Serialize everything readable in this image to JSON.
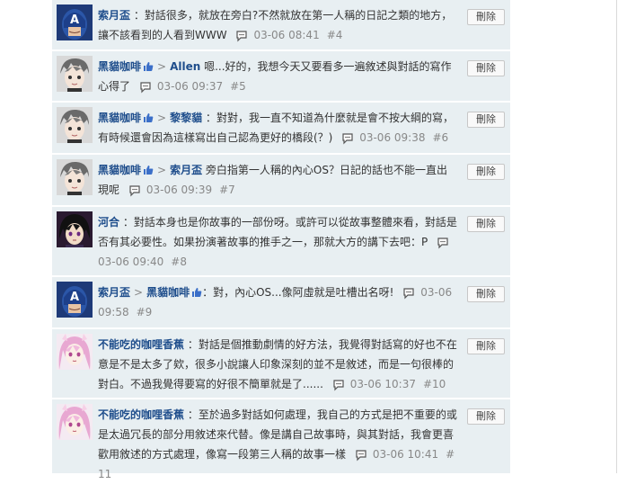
{
  "delete_label": "刪除",
  "comments": [
    {
      "author": "索月盃",
      "reply_to": "",
      "text": "對話很多，就放在旁白?不然就放在第一人稱的日記之類的地方，讓不該看到的人看到WWW",
      "time": "03-06 08:41",
      "floor": "#4",
      "avatar": "captain-america-avatar"
    },
    {
      "author": "黑貓咖啡",
      "reply_to": "Allen",
      "text": "嗯...好的，我想今天又要看多一遍敘述與對話的寫作心得了",
      "time": "03-06 09:37",
      "floor": "#5",
      "avatar": "anime-boy-avatar"
    },
    {
      "author": "黑貓咖啡",
      "reply_to": "黎黎貓",
      "text": "對對，我一直不知道為什麼就是會不按大綱的寫，有時候還會因為這樣寫出自己認為更好的橋段(？)",
      "time": "03-06 09:38",
      "floor": "#6",
      "avatar": "anime-boy-avatar"
    },
    {
      "author": "黑貓咖啡",
      "reply_to": "索月盃",
      "text": "旁白指第一人稱的內心OS？日記的話也不能一直出現呢",
      "time": "03-06 09:39",
      "floor": "#7",
      "avatar": "anime-boy-avatar"
    },
    {
      "author": "河合",
      "reply_to": "",
      "text": "對話本身也是你故事的一部份呀。或許可以從故事整體來看，對話是否有其必要性。如果扮演著故事的推手之一，那就大方的講下去吧：P",
      "time": "03-06 09:40",
      "floor": "#8",
      "avatar": "dark-hair-avatar"
    },
    {
      "author": "索月盃",
      "reply_to": "黑貓咖啡",
      "text": "對，內心OS...像阿虛就是吐槽出名呀!",
      "time": "03-06 09:58",
      "floor": "#9",
      "avatar": "captain-america-avatar"
    },
    {
      "author": "不能吃的咖哩香蕉",
      "reply_to": "",
      "text": "對話是個推動劇情的好方法，我覺得對話寫的好也不在意是不是太多了欸，很多小說讓人印象深刻的並不是敘述，而是一句很棒的對白。不過我覺得要寫的好很不簡單就是了......",
      "time": "03-06 10:37",
      "floor": "#10",
      "avatar": "pink-hair-avatar"
    },
    {
      "author": "不能吃的咖哩香蕉",
      "reply_to": "",
      "text": "至於過多對話如何處理，我自己的方式是把不重要的或是太過冗長的部分用敘述來代替。像是講自己故事時，與其對話，我會更喜歡用敘述的方式處理，像寫一段第三人稱的故事一樣",
      "time": "03-06 10:41",
      "floor": "#11",
      "avatar": "pink-hair-avatar"
    }
  ]
}
